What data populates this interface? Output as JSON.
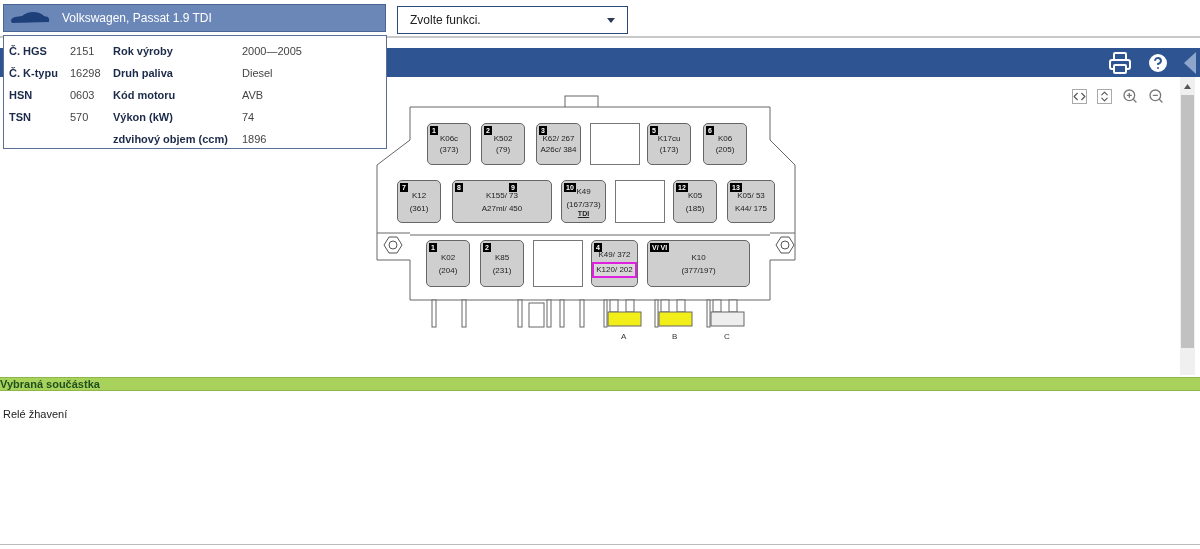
{
  "vehicle": {
    "title": "Volkswagen, Passat 1.9 TDI"
  },
  "function_select": {
    "value": "Zvolte funkci."
  },
  "vehicle_info": [
    {
      "label": "Č. HGS",
      "value": "2151",
      "label2": "Rok výroby",
      "value2": "2000—2005"
    },
    {
      "label": "Č. K-typu",
      "value": "16298",
      "label2": "Druh paliva",
      "value2": "Diesel"
    },
    {
      "label": "HSN",
      "value": "0603",
      "label2": "Kód motoru",
      "value2": "AVB"
    },
    {
      "label": "TSN",
      "value": "570",
      "label2": "Výkon (kW)",
      "value2": "74"
    },
    {
      "label2": "zdvihový objem (ccm)",
      "value2": "1896"
    }
  ],
  "diagram": {
    "rows": [
      {
        "slots": [
          {
            "kind": "relay",
            "numbers": [
              "1"
            ],
            "lines": [
              {
                "text": "K06c",
                "selected": false
              },
              {
                "text": "(373)",
                "selected": false
              }
            ]
          },
          {
            "kind": "relay",
            "numbers": [
              "2"
            ],
            "lines": [
              {
                "text": "K502",
                "selected": false
              },
              {
                "text": "(79)",
                "selected": false
              }
            ]
          },
          {
            "kind": "relay",
            "numbers": [
              "3"
            ],
            "lines": [
              {
                "text": "K62/ 267",
                "selected": false
              },
              {
                "text": "A26c/ 384",
                "selected": false
              }
            ]
          },
          {
            "kind": "empty"
          },
          {
            "kind": "relay",
            "numbers": [
              "5"
            ],
            "lines": [
              {
                "text": "K17cu",
                "selected": false
              },
              {
                "text": "(173)",
                "selected": false
              }
            ]
          },
          {
            "kind": "relay",
            "numbers": [
              "6"
            ],
            "lines": [
              {
                "text": "K06",
                "selected": false
              },
              {
                "text": "(205)",
                "selected": false
              }
            ]
          }
        ]
      },
      {
        "slots": [
          {
            "kind": "relay",
            "numbers": [
              "7"
            ],
            "lines": [
              {
                "text": "K12",
                "selected": false
              },
              {
                "text": "(361)",
                "selected": false
              }
            ]
          },
          {
            "kind": "relay",
            "numbers": [
              "8",
              "9"
            ],
            "lines": [
              {
                "text": "K155/ 73",
                "selected": false
              },
              {
                "text": "A27ml/ 450",
                "selected": false
              }
            ]
          },
          {
            "kind": "relay",
            "numbers": [
              "10"
            ],
            "lines": [
              {
                "text": "K49",
                "selected": false
              },
              {
                "text": "(167/373)",
                "selected": false
              }
            ],
            "tag": "TDI"
          },
          {
            "kind": "empty"
          },
          {
            "kind": "relay",
            "numbers": [
              "12"
            ],
            "lines": [
              {
                "text": "K05",
                "selected": false
              },
              {
                "text": "(185)",
                "selected": false
              }
            ]
          },
          {
            "kind": "relay",
            "numbers": [
              "13"
            ],
            "lines": [
              {
                "text": "K05/ 53",
                "selected": false
              },
              {
                "text": "K44/ 175",
                "selected": false
              }
            ]
          }
        ]
      },
      {
        "slots": [
          {
            "kind": "relay",
            "numbers": [
              "1"
            ],
            "lines": [
              {
                "text": "K02",
                "selected": false
              },
              {
                "text": "(204)",
                "selected": false
              }
            ]
          },
          {
            "kind": "relay",
            "numbers": [
              "2"
            ],
            "lines": [
              {
                "text": "K85",
                "selected": false
              },
              {
                "text": "(231)",
                "selected": false
              }
            ]
          },
          {
            "kind": "empty"
          },
          {
            "kind": "relay",
            "numbers": [
              "4"
            ],
            "lines": [
              {
                "text": "K49/ 372",
                "selected": false
              },
              {
                "text": "K120/ 202",
                "selected": true
              }
            ]
          },
          {
            "kind": "relay",
            "numbers": [
              "V/ VI"
            ],
            "lines": [
              {
                "text": "K10",
                "selected": false
              },
              {
                "text": "(377/197)",
                "selected": false
              }
            ]
          }
        ]
      }
    ],
    "connectors": [
      {
        "label": "A",
        "color": "#f2ee1a"
      },
      {
        "label": "B",
        "color": "#f2ee1a"
      },
      {
        "label": "C",
        "color": "#eeeeee"
      }
    ]
  },
  "selected_part": {
    "title": "Vybraná součástka",
    "text": "Relé žhavení"
  }
}
